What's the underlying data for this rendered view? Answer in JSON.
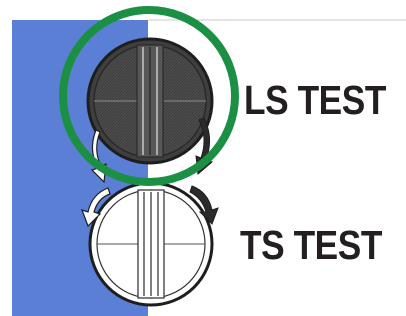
{
  "labels": {
    "top": "LS TEST",
    "bottom": "TS TEST"
  },
  "colors": {
    "panel": "#5b7fd4",
    "panel_divider": "#4a6cc4",
    "highlight_ring": "#1b8f43",
    "knob_dark": "#4b4b4b",
    "knob_light": "#ffffff",
    "outline": "#1e1e1e",
    "arrow_dark": "#2b2b2b",
    "arrow_light": "#ffffff"
  },
  "icons": {
    "top_knob": "ls-test-knob-pressed-icon",
    "bottom_knob": "ts-test-knob-released-icon",
    "rotation_arrows": "rotation-arrow-icon",
    "highlight": "highlight-circle-icon"
  }
}
